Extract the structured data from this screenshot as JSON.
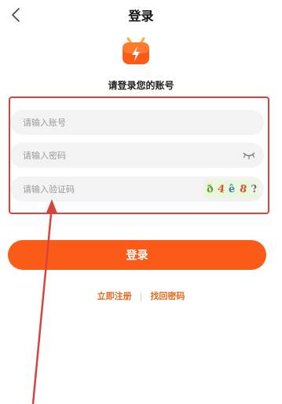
{
  "header": {
    "title": "登录",
    "back_icon": "chevron-left-icon"
  },
  "logo": {
    "icon": "tv-lightning-icon",
    "colors": {
      "body": "#fb5b16",
      "antenna": "#f3b13a",
      "bolt": "#ffffff"
    }
  },
  "subtitle": "请登录您的账号",
  "form": {
    "account_placeholder": "请输入账号",
    "password_placeholder": "请输入密码",
    "password_toggle_icon": "eye-closed-icon",
    "captcha_placeholder": "请输入验证码",
    "captcha_chars": [
      "ð",
      "4",
      "ê",
      "8",
      "?"
    ]
  },
  "buttons": {
    "login": "登录"
  },
  "links": {
    "register": "立即注册",
    "separator": "|",
    "forgot": "找回密码"
  },
  "annotation": {
    "highlight_color": "#d7443e",
    "arrow_color": "#d7443e"
  },
  "colors": {
    "accent": "#fb5b16",
    "link": "#e86a1e",
    "field_bg": "#f3f3f3"
  }
}
